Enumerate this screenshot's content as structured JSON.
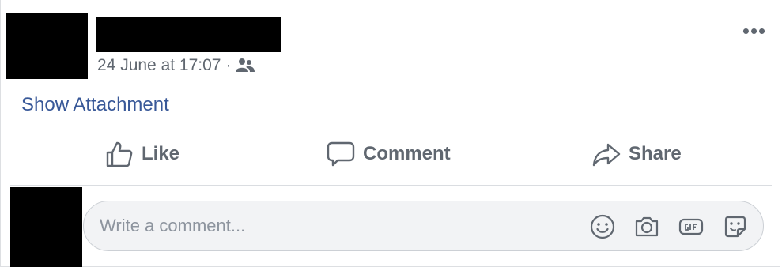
{
  "post": {
    "timestamp": "24 June at 17:07",
    "separator": "·",
    "audience_icon": "friends-icon",
    "more_icon": "ellipsis-icon",
    "more_label": "•••",
    "attachment_link": "Show Attachment"
  },
  "actions": {
    "like_label": "Like",
    "comment_label": "Comment",
    "share_label": "Share"
  },
  "composer": {
    "placeholder": "Write a comment...",
    "tools": [
      "emoji-icon",
      "camera-icon",
      "gif-icon",
      "sticker-icon"
    ]
  },
  "colors": {
    "link": "#385898",
    "muted": "#606770",
    "input_bg": "#f2f3f5",
    "redaction": "#000000"
  }
}
